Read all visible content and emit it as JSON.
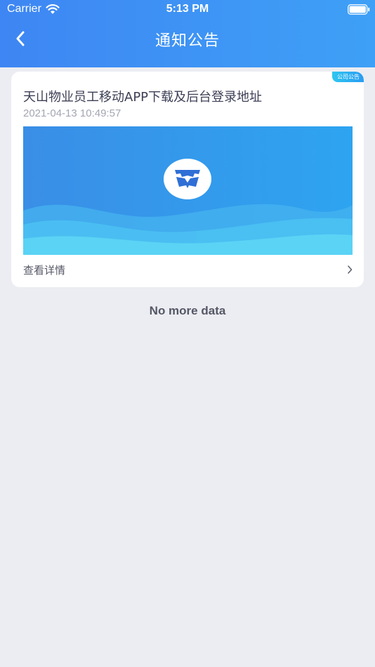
{
  "status_bar": {
    "carrier": "Carrier",
    "time": "5:13 PM"
  },
  "nav": {
    "title": "通知公告"
  },
  "colors": {
    "header_start": "#3e86f3",
    "header_end": "#3ea0f6",
    "page_background": "#ecedf2",
    "tag_start": "#2fc6f0",
    "tag_end": "#2a9cf2"
  },
  "notices": [
    {
      "tag": "公司公告",
      "title": "天山物业员工移动APP下载及后台登录地址",
      "date": "2021-04-13 10:49:57",
      "details_label": "查看详情"
    }
  ],
  "footer": {
    "no_more_text": "No more data"
  }
}
